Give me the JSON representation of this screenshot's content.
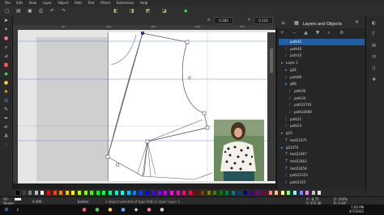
{
  "menubar": {
    "items": [
      "File",
      "Edit",
      "View",
      "Layer",
      "Object",
      "Path",
      "Text",
      "Filters",
      "Extensions",
      "Help"
    ]
  },
  "controls": {
    "x_label": "X:",
    "x_value": "0.283",
    "y_label": "Y:",
    "y_value": "0.110"
  },
  "ruler_labels": [
    "50",
    "100",
    "150",
    "200",
    "250"
  ],
  "panel": {
    "title": "Layers and Objects",
    "close_glyph": "✕",
    "tree": [
      {
        "label": "path41",
        "selected": true,
        "indent": 1
      },
      {
        "label": "path40",
        "indent": 1
      },
      {
        "label": "path35",
        "indent": 1
      },
      {
        "label": "Layer 1",
        "indent": 0
      },
      {
        "label": "g28",
        "indent": 1
      },
      {
        "label": "path89",
        "indent": 1
      },
      {
        "label": "g88",
        "indent": 1
      },
      {
        "label": "path36",
        "indent": 2
      },
      {
        "label": "path34",
        "indent": 2
      },
      {
        "label": "path22701",
        "indent": 2
      },
      {
        "label": "path22689",
        "indent": 2
      },
      {
        "label": "path21",
        "indent": 1
      },
      {
        "label": "path23",
        "indent": 1
      },
      {
        "label": "g23",
        "indent": 0
      },
      {
        "label": "text22475",
        "indent": 1
      },
      {
        "label": "g22476",
        "indent": 0
      },
      {
        "label": "text22467",
        "indent": 1
      },
      {
        "label": "text22463",
        "indent": 1
      },
      {
        "label": "text22459",
        "indent": 1
      },
      {
        "label": "path21333",
        "indent": 1
      },
      {
        "label": "path2145",
        "indent": 1
      }
    ]
  },
  "status": {
    "fill_label": "Fill:",
    "stroke_label": "Stroke:",
    "opacity": "0.400",
    "layer": "bodice",
    "selection_text": "1 object selected of type Path in layer Layer 1",
    "x": "X: -8.75",
    "y": "Y: 375.46",
    "z": "Z: 100%",
    "r": "R: 0.00°"
  },
  "taskbar": {
    "time": "7:00 PM",
    "date": "4/7/2022"
  },
  "colors": {
    "accent": "#1f5fa9",
    "pattern_line": "#555555",
    "guide": "#3a7bd5",
    "node_selected": "#2c3e8f"
  },
  "palette": [
    "#000000",
    "#404040",
    "#808080",
    "#bfbfbf",
    "#ffffff",
    "#ff0000",
    "#ff4000",
    "#ff8000",
    "#ffbf00",
    "#ffff00",
    "#bfff00",
    "#80ff00",
    "#40ff00",
    "#00ff00",
    "#00ff40",
    "#00ff80",
    "#00ffbf",
    "#00ffff",
    "#00bfff",
    "#0080ff",
    "#0040ff",
    "#0000ff",
    "#4000ff",
    "#8000ff",
    "#bf00ff",
    "#ff00ff",
    "#ff00bf",
    "#ff0080",
    "#ff0040",
    "#800000",
    "#804000",
    "#808000",
    "#408000",
    "#008000",
    "#008040",
    "#008080",
    "#004080",
    "#000080",
    "#400080",
    "#800080",
    "#800040",
    "#ff8080",
    "#ffbf80",
    "#ffff80",
    "#80ff80",
    "#80ffff",
    "#8080ff",
    "#ff80ff",
    "#c0c0c0",
    "#e8e8e8"
  ]
}
